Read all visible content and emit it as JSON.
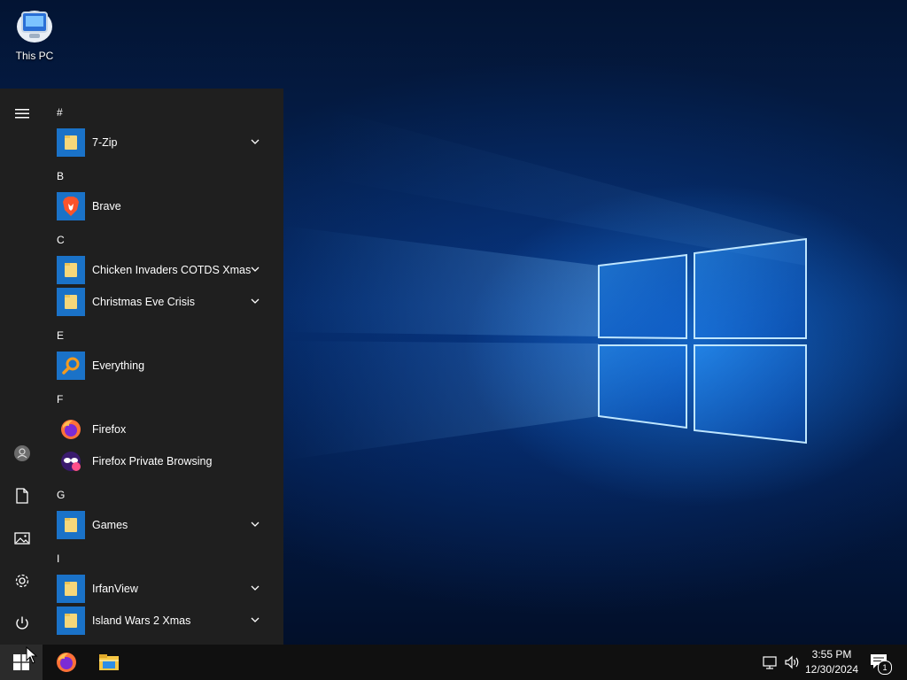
{
  "desktop": {
    "icons": [
      {
        "label": "This PC",
        "icon": "this-pc-icon"
      }
    ]
  },
  "start_menu": {
    "rail": [
      {
        "name": "hamburger-menu-icon"
      },
      {
        "name": "user-account-icon"
      },
      {
        "name": "documents-icon"
      },
      {
        "name": "pictures-icon"
      },
      {
        "name": "settings-icon"
      },
      {
        "name": "power-icon"
      }
    ],
    "groups": [
      {
        "letter": "#",
        "apps": [
          {
            "label": "7-Zip",
            "icon": "folder-icon",
            "expandable": true
          }
        ]
      },
      {
        "letter": "B",
        "apps": [
          {
            "label": "Brave",
            "icon": "brave-icon",
            "expandable": false
          }
        ]
      },
      {
        "letter": "C",
        "apps": [
          {
            "label": "Chicken Invaders COTDS Xmas",
            "icon": "folder-icon",
            "expandable": true
          },
          {
            "label": "Christmas Eve Crisis",
            "icon": "folder-icon",
            "expandable": true
          }
        ]
      },
      {
        "letter": "E",
        "apps": [
          {
            "label": "Everything",
            "icon": "search-icon",
            "expandable": false
          }
        ]
      },
      {
        "letter": "F",
        "apps": [
          {
            "label": "Firefox",
            "icon": "firefox-icon",
            "expandable": false
          },
          {
            "label": "Firefox Private Browsing",
            "icon": "firefox-private-icon",
            "expandable": false
          }
        ]
      },
      {
        "letter": "G",
        "apps": [
          {
            "label": "Games",
            "icon": "folder-icon",
            "expandable": true
          }
        ]
      },
      {
        "letter": "I",
        "apps": [
          {
            "label": "IrfanView",
            "icon": "folder-icon",
            "expandable": true
          },
          {
            "label": "Island Wars 2 Xmas",
            "icon": "folder-icon",
            "expandable": true
          }
        ]
      }
    ]
  },
  "taskbar": {
    "pinned": [
      {
        "name": "start-button",
        "icon": "windows-logo-icon"
      },
      {
        "name": "firefox-taskbar-button",
        "icon": "firefox-icon"
      },
      {
        "name": "file-explorer-taskbar-button",
        "icon": "file-explorer-icon"
      }
    ],
    "tray": {
      "time": "3:55 PM",
      "date": "12/30/2024",
      "notification_count": "1"
    }
  },
  "colors": {
    "start_bg": "#1f1f1f",
    "taskbar_bg": "#101010",
    "tile_blue": "#1a72c8",
    "folder_yellow": "#f6d77a"
  }
}
